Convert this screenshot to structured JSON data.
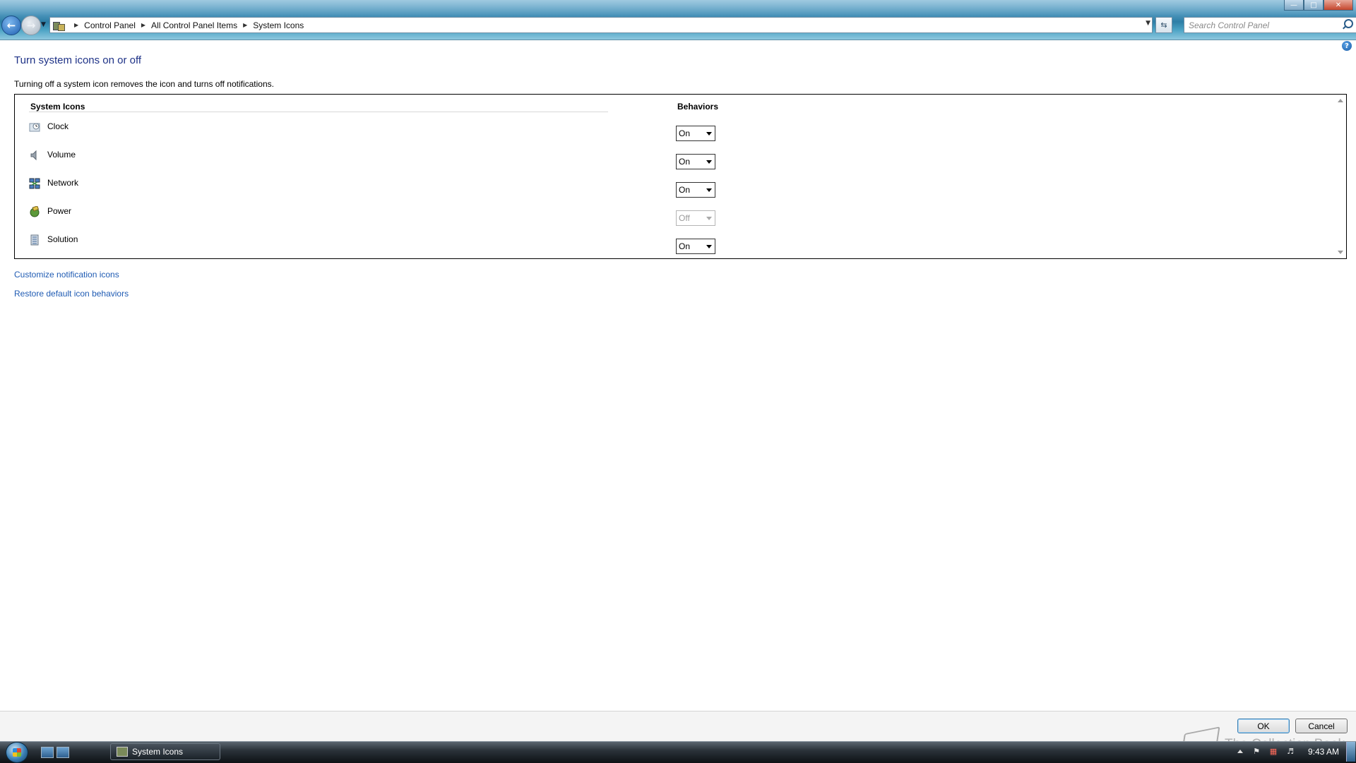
{
  "window": {
    "breadcrumbs": [
      "Control Panel",
      "All Control Panel Items",
      "System Icons"
    ],
    "search_placeholder": "Search Control Panel"
  },
  "page": {
    "title": "Turn system icons on or off",
    "description": "Turning off a system icon removes the icon and turns off notifications."
  },
  "table": {
    "col_icons": "System Icons",
    "col_behaviors": "Behaviors",
    "rows": [
      {
        "name": "Clock",
        "icon": "clock-icon",
        "behavior": "On",
        "disabled": false
      },
      {
        "name": "Volume",
        "icon": "volume-icon",
        "behavior": "On",
        "disabled": false
      },
      {
        "name": "Network",
        "icon": "network-icon",
        "behavior": "On",
        "disabled": false
      },
      {
        "name": "Power",
        "icon": "power-icon",
        "behavior": "Off",
        "disabled": true
      },
      {
        "name": "Solution",
        "icon": "solution-icon",
        "behavior": "On",
        "disabled": false
      }
    ]
  },
  "links": {
    "customize": "Customize notification icons",
    "restore": "Restore default icon behaviors"
  },
  "buttons": {
    "ok": "OK",
    "cancel": "Cancel"
  },
  "taskbar": {
    "window_button": "System Icons",
    "clock": "9:43 AM"
  },
  "watermark": "The Collection Book",
  "colors": {
    "title_blue": "#1e3287",
    "link_blue": "#1f5bb3"
  }
}
